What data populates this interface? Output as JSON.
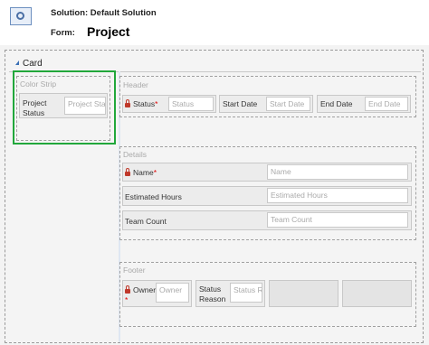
{
  "header": {
    "solution_label": "Solution: Default Solution",
    "form_label": "Form:",
    "form_name": "Project"
  },
  "tab": {
    "title": "Card"
  },
  "color_strip": {
    "title": "Color Strip",
    "field_label": "Project Status",
    "field_label_line1": "Project",
    "field_label_line2": "Status",
    "field_placeholder": "Project Sta"
  },
  "header_section": {
    "title": "Header",
    "status_label": "Status",
    "status_placeholder": "Status",
    "start_label": "Start Date",
    "start_placeholder": "Start Date",
    "end_label": "End Date",
    "end_placeholder": "End Date"
  },
  "details": {
    "title": "Details",
    "name_label": "Name",
    "name_placeholder": "Name",
    "hours_label": "Estimated Hours",
    "hours_placeholder": "Estimated Hours",
    "team_label": "Team Count",
    "team_placeholder": "Team Count"
  },
  "footer": {
    "title": "Footer",
    "owner_label": "Owner",
    "owner_placeholder": "Owner",
    "status_reason_line1": "Status",
    "status_reason_line2": "Reason",
    "status_reason_placeholder": "Status R"
  },
  "required_mark": "*",
  "colors": {
    "selection": "#21a73b",
    "required": "#dd0000",
    "accent": "#3a6fb5"
  }
}
